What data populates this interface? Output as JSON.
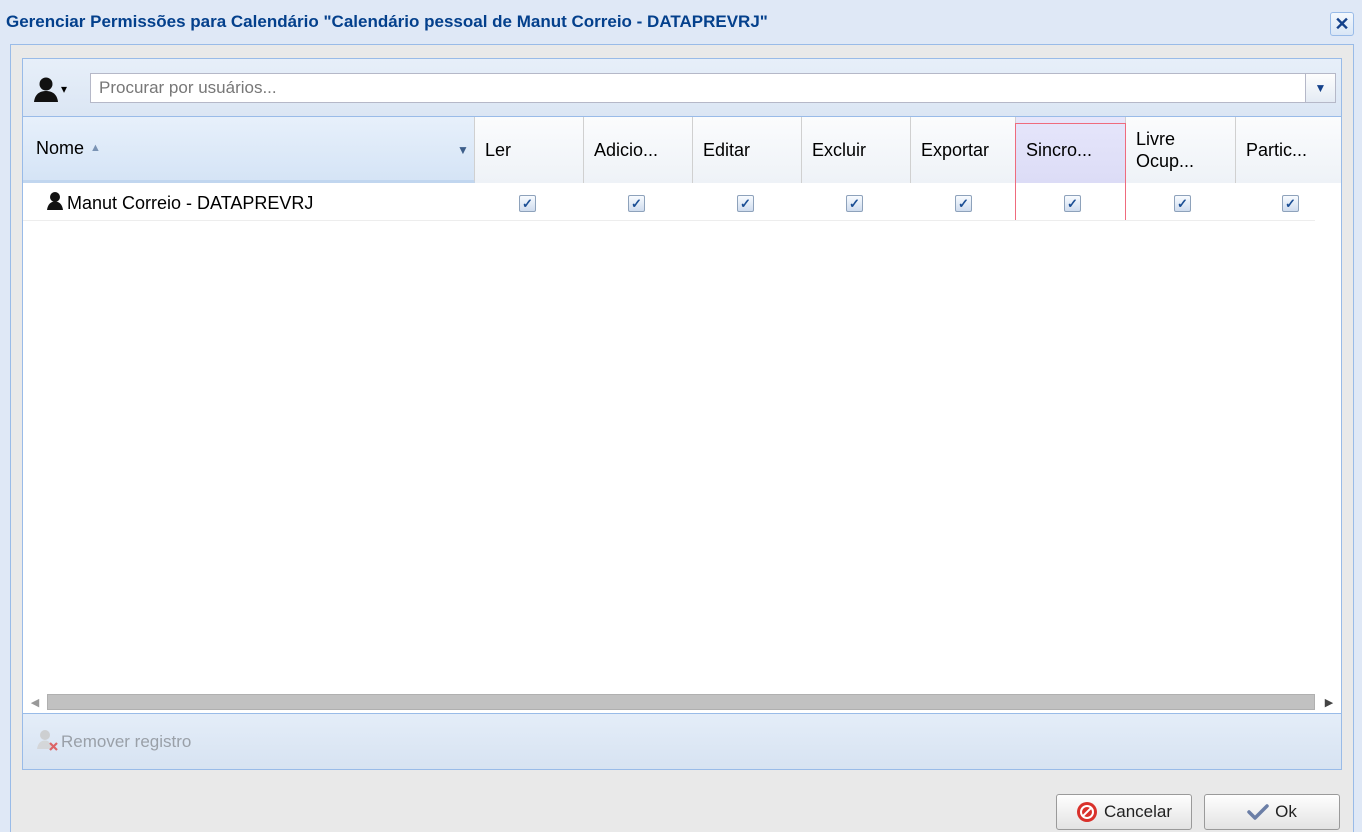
{
  "window": {
    "title": "Gerenciar Permissões para Calendário \"Calendário pessoal de Manut Correio - DATAPREVRJ\"",
    "close_glyph": "✕"
  },
  "toolbar": {
    "user_icon": "user-icon",
    "search_placeholder": "Procurar por usuários...",
    "search_value": ""
  },
  "grid": {
    "columns": [
      {
        "key": "nome",
        "label": "Nome",
        "sorted": "asc"
      },
      {
        "key": "ler",
        "label": "Ler"
      },
      {
        "key": "adicionar",
        "label": "Adicio..."
      },
      {
        "key": "editar",
        "label": "Editar"
      },
      {
        "key": "excluir",
        "label": "Excluir"
      },
      {
        "key": "exportar",
        "label": "Exportar"
      },
      {
        "key": "sincronizar",
        "label": "Sincro...",
        "highlighted": true
      },
      {
        "key": "livre_ocupado",
        "label_line1": "Livre",
        "label_line2": "Ocup..."
      },
      {
        "key": "particular",
        "label": "Partic..."
      }
    ],
    "rows": [
      {
        "name": "Manut Correio - DATAPREVRJ",
        "ler": true,
        "adicionar": true,
        "editar": true,
        "excluir": true,
        "exportar": true,
        "sincronizar": true,
        "livre_ocupado": true,
        "particular": true
      }
    ]
  },
  "bottom_toolbar": {
    "remove_label": "Remover registro"
  },
  "footer": {
    "cancel_label": "Cancelar",
    "ok_label": "Ok"
  },
  "colors": {
    "title": "#04408c",
    "frame_border": "#99bbe8",
    "window_bg": "#dfe8f6",
    "focus_border": "#ef6b7d"
  }
}
